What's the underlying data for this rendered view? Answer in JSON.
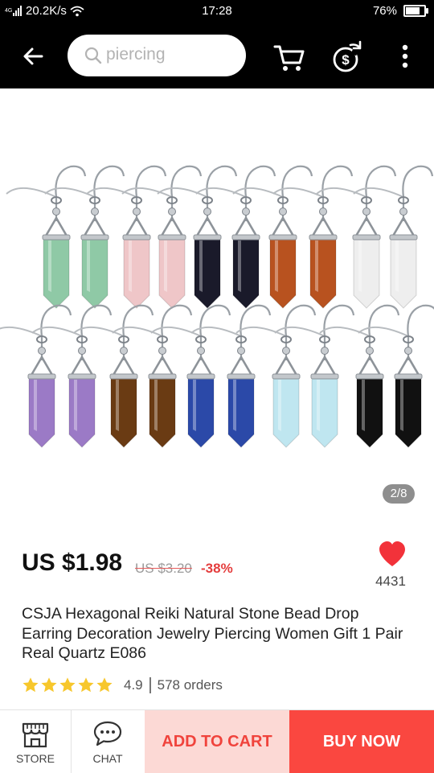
{
  "status_bar": {
    "network_speed": "20.2K/s",
    "time": "17:28",
    "battery_percent": "76%",
    "battery_level": 0.76
  },
  "header": {
    "search_text": "piercing",
    "icons": [
      "back-arrow-icon",
      "search-icon",
      "cart-icon",
      "share-coin-icon",
      "more-vertical-icon"
    ]
  },
  "gallery": {
    "image_counter": "2/8",
    "row1_stones": [
      "#8fc9a6",
      "#8fc9a6",
      "#efc6c8",
      "#efc6c8",
      "#1a1a2a",
      "#1a1a2a",
      "#b8521f",
      "#b8521f",
      "#eeeeee",
      "#eeeeee"
    ],
    "row2_stones": [
      "#9b7ac6",
      "#9b7ac6",
      "#6a3b13",
      "#6a3b13",
      "#2b49a8",
      "#2b49a8",
      "#bfe6f0",
      "#bfe6f0",
      "#111111",
      "#111111"
    ]
  },
  "product": {
    "price": "US $1.98",
    "original_price": "US $3.20",
    "discount": "-38%",
    "wishlist_count": "4431",
    "title": "CSJA Hexagonal Reiki Natural Stone Bead Drop Earring Decoration Jewelry Piercing Women Gift 1 Pair Real Quartz E086",
    "rating": "4.9",
    "stars": 5,
    "orders": "578 orders"
  },
  "bottom_bar": {
    "store_label": "STORE",
    "chat_label": "CHAT",
    "add_to_cart_label": "ADD TO CART",
    "buy_now_label": "BUY NOW"
  },
  "colors": {
    "accent": "#fa4740",
    "add_to_cart_bg": "#fcd9d5",
    "star": "#f7c72c"
  }
}
